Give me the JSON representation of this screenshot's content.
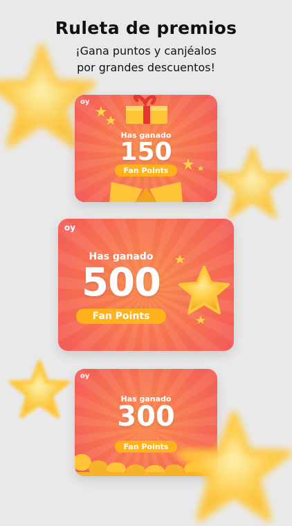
{
  "header": {
    "title": "Ruleta de premios",
    "subtitle_line1": "¡Gana puntos y canjéalos",
    "subtitle_line2": "por grandes descuentos!"
  },
  "cards": [
    {
      "logo": "oy",
      "label": "Has ganado",
      "points": "150",
      "badge": "Fan Points",
      "decoration": "gift-box"
    },
    {
      "logo": "oy",
      "label": "Has ganado",
      "points": "500",
      "badge": "Fan Points",
      "decoration": "star"
    },
    {
      "logo": "oy",
      "label": "Has ganado",
      "points": "300",
      "badge": "Fan Points",
      "decoration": "coins"
    }
  ],
  "colors": {
    "background": "#e9e9e9",
    "card_orange": "#f98a4a",
    "card_red": "#f35a58",
    "badge_yellow": "#ffb21a",
    "star_yellow": "#ffc83a"
  }
}
